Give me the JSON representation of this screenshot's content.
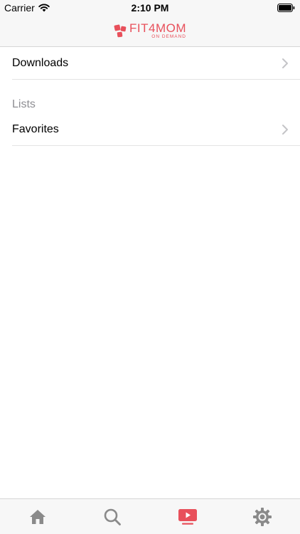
{
  "status_bar": {
    "carrier": "Carrier",
    "time": "2:10 PM"
  },
  "header": {
    "logo_main": "FIT4MOM",
    "logo_sub": "ON DEMAND"
  },
  "list": {
    "downloads_label": "Downloads",
    "section_header": "Lists",
    "favorites_label": "Favorites"
  },
  "tab_bar": {
    "tabs": [
      {
        "icon": "home-icon",
        "active": false
      },
      {
        "icon": "search-icon",
        "active": false
      },
      {
        "icon": "play-screen-icon",
        "active": true
      },
      {
        "icon": "gear-icon",
        "active": false
      }
    ]
  },
  "colors": {
    "accent": "#e8505b",
    "inactive_icon": "#8a8a8a",
    "section_header": "#8e8e93"
  }
}
